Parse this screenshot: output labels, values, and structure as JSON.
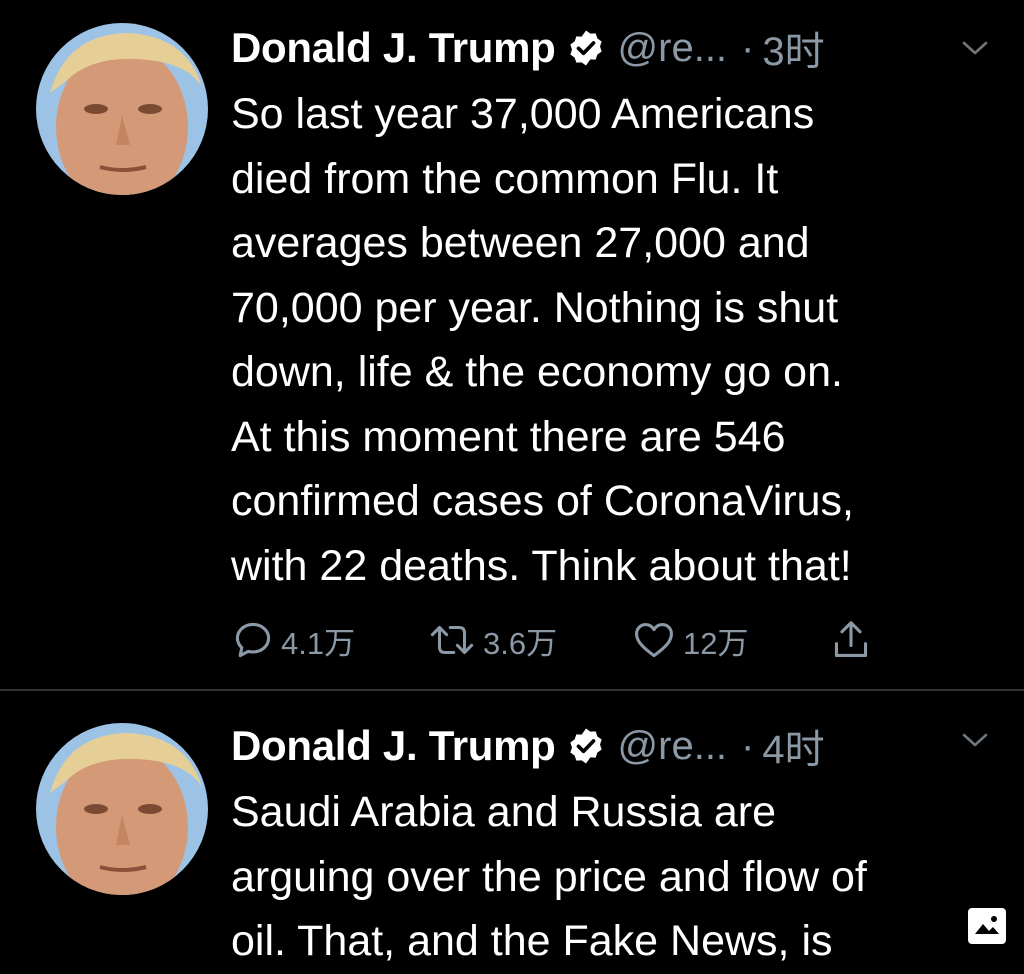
{
  "tweets": [
    {
      "name": "Donald J. Trump",
      "handle": "@re...",
      "separator": "·",
      "time": "3时",
      "lines": [
        "So last year 37,000 Americans",
        "died from the common Flu. It",
        "averages between 27,000 and",
        "70,000 per year. Nothing is shut",
        "down, life & the economy go on.",
        "At this moment there are 546",
        "confirmed cases of CoronaVirus,",
        "with 22 deaths. Think about that!"
      ],
      "actions": {
        "replies": "4.1万",
        "retweets": "3.6万",
        "likes": "12万"
      }
    },
    {
      "name": "Donald J. Trump",
      "handle": "@re...",
      "separator": "·",
      "time": "4时",
      "lines": [
        "Saudi Arabia and Russia are",
        "arguing over the price and flow of",
        "oil. That, and the Fake News, is"
      ]
    }
  ],
  "icons": {
    "verified": "verified-badge-icon",
    "menu": "chevron-down-icon",
    "reply": "reply-bubble-icon",
    "retweet": "retweet-icon",
    "like": "heart-icon",
    "share": "share-icon",
    "photo": "image-icon"
  },
  "colors": {
    "background": "#000000",
    "text": "#ffffff",
    "secondary": "#8b98a5",
    "divider": "#2f3336"
  }
}
